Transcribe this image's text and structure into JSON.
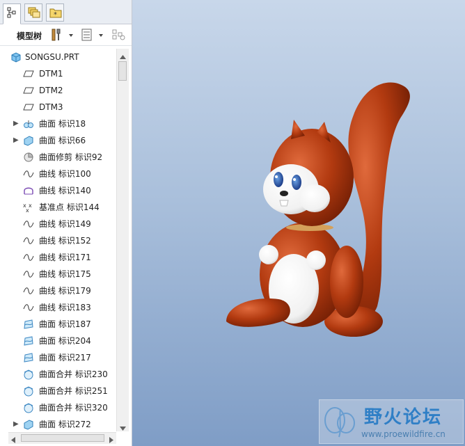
{
  "panel": {
    "tree_label": "模型树"
  },
  "tree": {
    "items": [
      {
        "label": "SONGSU.PRT",
        "icon": "part-icon"
      },
      {
        "label": "DTM1",
        "icon": "datum-plane-icon"
      },
      {
        "label": "DTM2",
        "icon": "datum-plane-icon"
      },
      {
        "label": "DTM3",
        "icon": "datum-plane-icon"
      },
      {
        "label": "曲面 标识18",
        "icon": "surface-group-icon"
      },
      {
        "label": "曲面 标识66",
        "icon": "surface-icon"
      },
      {
        "label": "曲面修剪 标识92",
        "icon": "trim-icon"
      },
      {
        "label": "曲线 标识100",
        "icon": "curve-icon"
      },
      {
        "label": "曲线 标识140",
        "icon": "curve-purple-icon"
      },
      {
        "label": "基准点 标识144",
        "icon": "datum-point-icon"
      },
      {
        "label": "曲线 标识149",
        "icon": "curve-icon"
      },
      {
        "label": "曲线 标识152",
        "icon": "curve-icon"
      },
      {
        "label": "曲线 标识171",
        "icon": "curve-icon"
      },
      {
        "label": "曲线 标识175",
        "icon": "curve-icon"
      },
      {
        "label": "曲线 标识179",
        "icon": "curve-icon"
      },
      {
        "label": "曲线 标识183",
        "icon": "curve-icon"
      },
      {
        "label": "曲面 标识187",
        "icon": "surface-blue-icon"
      },
      {
        "label": "曲面 标识204",
        "icon": "surface-blue-icon"
      },
      {
        "label": "曲面 标识217",
        "icon": "surface-blue-icon"
      },
      {
        "label": "曲面合并 标识230",
        "icon": "merge-icon"
      },
      {
        "label": "曲面合并 标识251",
        "icon": "merge-icon"
      },
      {
        "label": "曲面合并 标识320",
        "icon": "merge-icon"
      },
      {
        "label": "曲面 标识272",
        "icon": "surface-icon"
      }
    ]
  },
  "watermark": {
    "text": "野火论坛",
    "url": "www.proewildfire.cn"
  },
  "colors": {
    "fur": "#b23a10",
    "belly": "#ffffff",
    "viewport_top": "#c8d7ea",
    "viewport_bottom": "#7f9dc6"
  }
}
